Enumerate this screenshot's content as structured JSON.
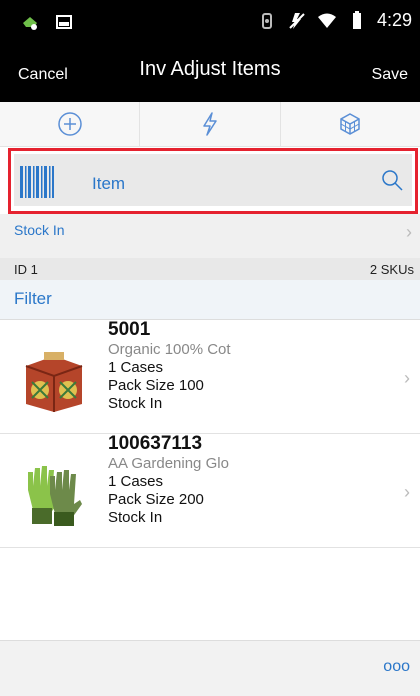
{
  "status_bar": {
    "time": "4:29",
    "icons": [
      "app-badge-icon",
      "image-icon",
      "vibrate-icon",
      "mute-icon",
      "wifi-icon",
      "battery-icon"
    ]
  },
  "header": {
    "cancel_label": "Cancel",
    "title": "Inv Adjust Items",
    "save_label": "Save"
  },
  "toolbar": {
    "buttons": [
      "add-icon",
      "lightning-icon",
      "cube-icon"
    ]
  },
  "search": {
    "placeholder": "Item"
  },
  "reason": {
    "label": "Stock In"
  },
  "summary": {
    "id_label": "ID 1",
    "sku_count": "2 SKUs"
  },
  "filter": {
    "label": "Filter"
  },
  "items": [
    {
      "number": "5001",
      "description": "Organic 100% Cot",
      "quantity": "1 Cases",
      "pack_size": "Pack Size 100",
      "reason": "Stock In",
      "thumb_icon": "crate-icon"
    },
    {
      "number": "100637113",
      "description": "AA Gardening Glo",
      "quantity": "1 Cases",
      "pack_size": "Pack Size 200",
      "reason": "Stock In",
      "thumb_icon": "gloves-icon"
    }
  ],
  "footer": {
    "more_label": "ooo"
  },
  "colors": {
    "accent": "#2b77c9",
    "highlight_border": "#e5222f",
    "header_bg": "#000000"
  }
}
